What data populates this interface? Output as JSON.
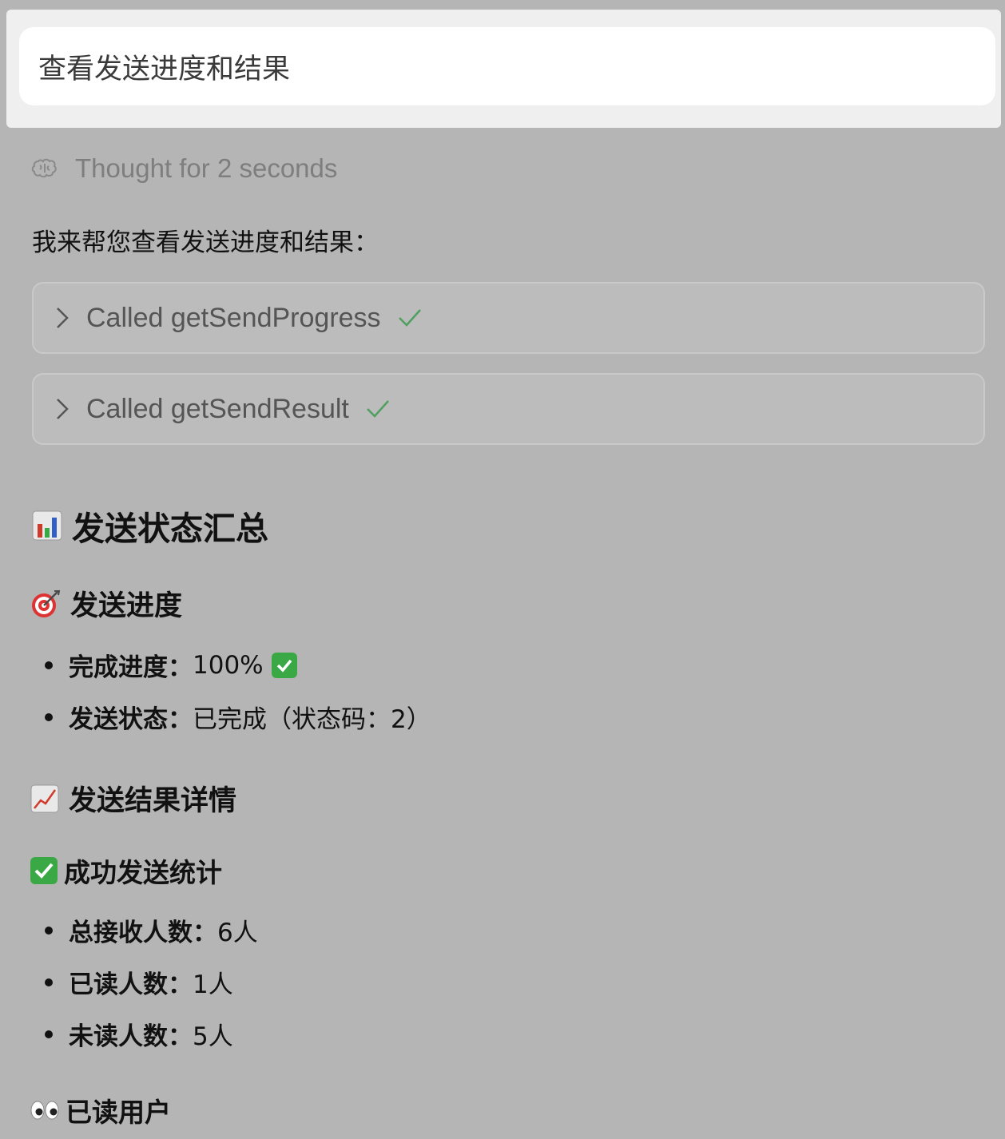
{
  "user_message": "查看发送进度和结果",
  "thought": {
    "label": "Thought for 2 seconds",
    "icon": "brain-icon"
  },
  "intro": "我来帮您查看发送进度和结果：",
  "tool_calls": [
    {
      "label": "Called getSendProgress",
      "status_icon": "check-icon"
    },
    {
      "label": "Called getSendResult",
      "status_icon": "check-icon"
    }
  ],
  "summary": {
    "title": "发送状态汇总",
    "title_icon": "bar-chart-icon",
    "progress_section": {
      "title": "发送进度",
      "icon": "target-icon",
      "items": [
        {
          "label": "完成进度：",
          "value": "100%",
          "icon": "green-check-icon"
        },
        {
          "label": "发送状态：",
          "value": "已完成（状态码：2）"
        }
      ]
    },
    "result_section": {
      "title": "发送结果详情",
      "icon": "trending-up-icon"
    },
    "success_section": {
      "title": "成功发送统计",
      "icon": "green-check-icon",
      "items": [
        {
          "label": "总接收人数：",
          "value": "6人"
        },
        {
          "label": "已读人数：",
          "value": "1人"
        },
        {
          "label": "未读人数：",
          "value": "5人"
        }
      ]
    },
    "read_users_section": {
      "title": "已读用户",
      "icon": "eyes-icon"
    }
  },
  "colors": {
    "background": "#b5b5b5",
    "user_card": "#ffffff",
    "check_green": "#4ea060",
    "emoji_green": "#3aa845"
  }
}
